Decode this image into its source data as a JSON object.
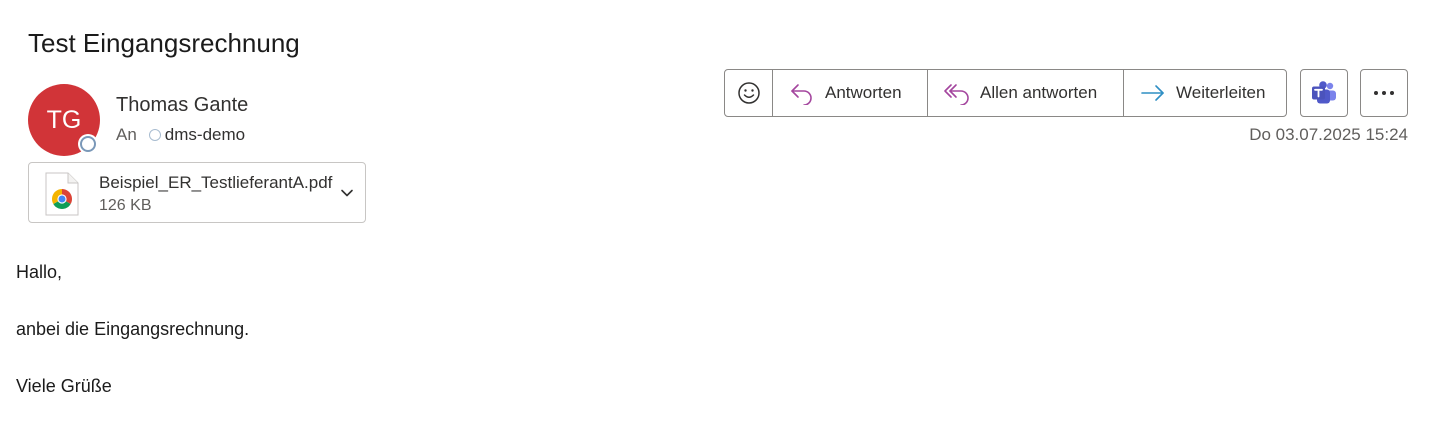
{
  "message": {
    "subject": "Test Eingangsrechnung",
    "sender": {
      "initials": "TG",
      "name": "Thomas Gante",
      "avatar_color": "#d13438"
    },
    "to_label": "An",
    "recipient": "dms-demo",
    "date": "Do 03.07.2025 15:24"
  },
  "attachment": {
    "icon": "chrome-pdf-icon",
    "filename": "Beispiel_ER_TestlieferantA.pdf",
    "size": "126 KB"
  },
  "actions": {
    "emoji_icon": "smiley-icon",
    "reply": "Antworten",
    "reply_all": "Allen antworten",
    "forward": "Weiterleiten",
    "teams_icon": "teams-icon",
    "more_icon": "more-icon",
    "accent_purple": "#a4469e",
    "accent_blue": "#2f8fc4"
  },
  "body": {
    "lines": [
      "Hallo,",
      "anbei die Eingangsrechnung.",
      "Viele Grüße"
    ]
  }
}
